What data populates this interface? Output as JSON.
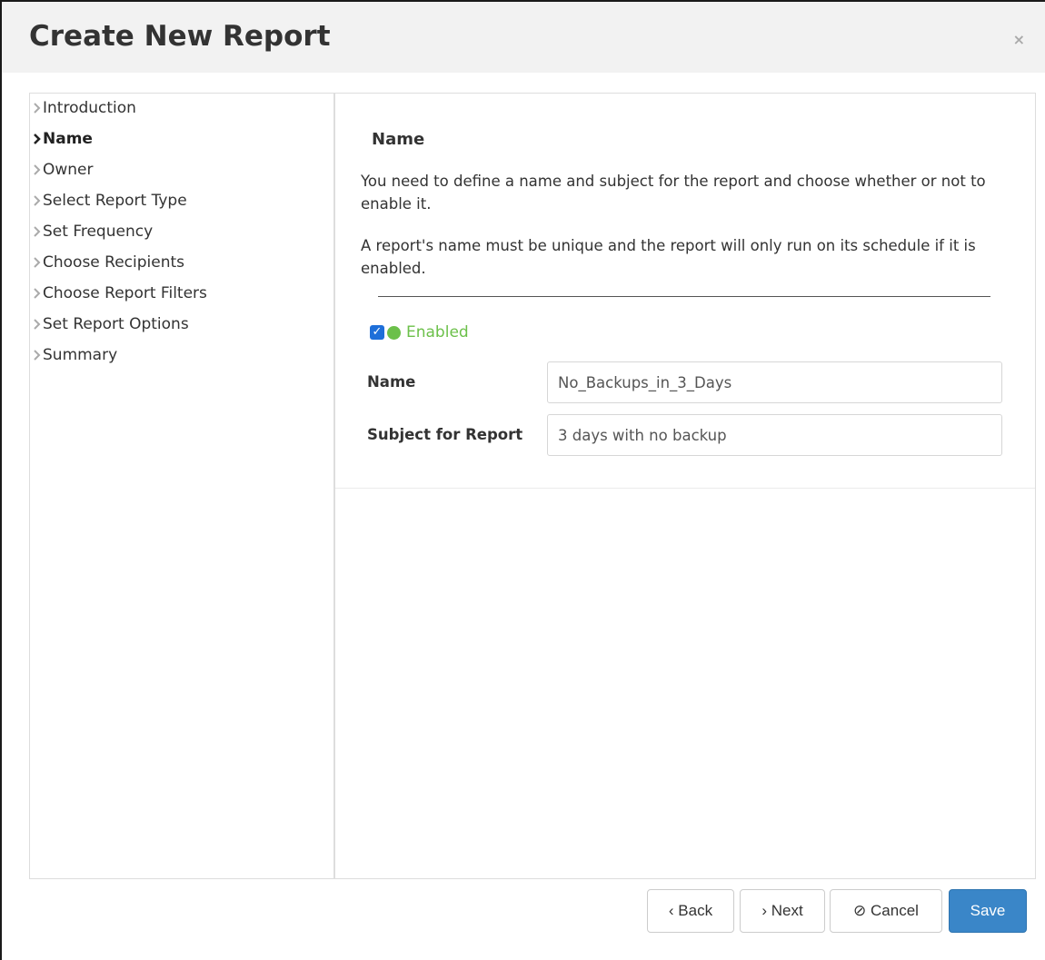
{
  "dialog": {
    "title": "Create New Report",
    "close_symbol": "×"
  },
  "sidebar": {
    "items": [
      {
        "label": "Introduction",
        "active": false
      },
      {
        "label": "Name",
        "active": true
      },
      {
        "label": "Owner",
        "active": false
      },
      {
        "label": "Select Report Type",
        "active": false
      },
      {
        "label": "Set Frequency",
        "active": false
      },
      {
        "label": "Choose Recipients",
        "active": false
      },
      {
        "label": "Choose Report Filters",
        "active": false
      },
      {
        "label": "Set Report Options",
        "active": false
      },
      {
        "label": "Summary",
        "active": false
      }
    ]
  },
  "main": {
    "section_title": "Name",
    "paragraph1": "You need to define a name and subject for the report and choose whether or not to enable it.",
    "paragraph2": "A report's name must be unique and the report will only run on its schedule if it is enabled.",
    "enabled": {
      "label": "Enabled",
      "checked": true,
      "checkmark": "✓"
    },
    "fields": {
      "name_label": "Name",
      "name_value": "No_Backups_in_3_Days",
      "subject_label": "Subject for Report",
      "subject_value": "3 days with no backup"
    }
  },
  "footer": {
    "back_label": "‹ Back",
    "next_label": "› Next",
    "cancel_label": "⊘ Cancel",
    "save_label": "Save"
  },
  "colors": {
    "primary": "#3a86c8",
    "enabled_green": "#6cc04a",
    "checkbox_blue": "#1e6fd9"
  }
}
